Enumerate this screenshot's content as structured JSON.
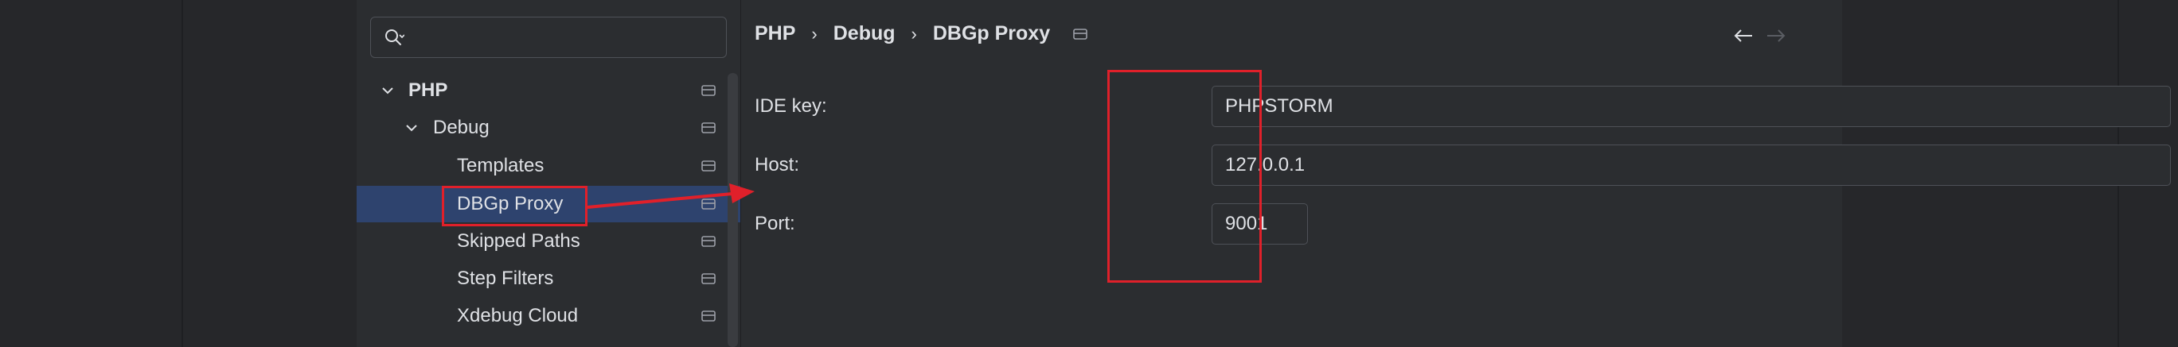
{
  "search": {
    "placeholder": ""
  },
  "tree": [
    {
      "label": "PHP",
      "bold": true,
      "expanded": true
    },
    {
      "label": "Debug",
      "bold": false,
      "expanded": true
    },
    {
      "label": "Templates",
      "bold": false
    },
    {
      "label": "DBGp Proxy",
      "bold": false,
      "selected": true
    },
    {
      "label": "Skipped Paths",
      "bold": false
    },
    {
      "label": "Step Filters",
      "bold": false
    },
    {
      "label": "Xdebug Cloud",
      "bold": false
    }
  ],
  "breadcrumb": [
    "PHP",
    "Debug",
    "DBGp Proxy"
  ],
  "breadcrumb_separator": "›",
  "fields": {
    "ide_key": {
      "label": "IDE key:",
      "value": "PHPSTORM"
    },
    "host": {
      "label": "Host:",
      "value": "127.0.0.1"
    },
    "port": {
      "label": "Port:",
      "value": "9001"
    }
  },
  "colors": {
    "selection": "#2e436e",
    "annotation": "#e0202a"
  }
}
